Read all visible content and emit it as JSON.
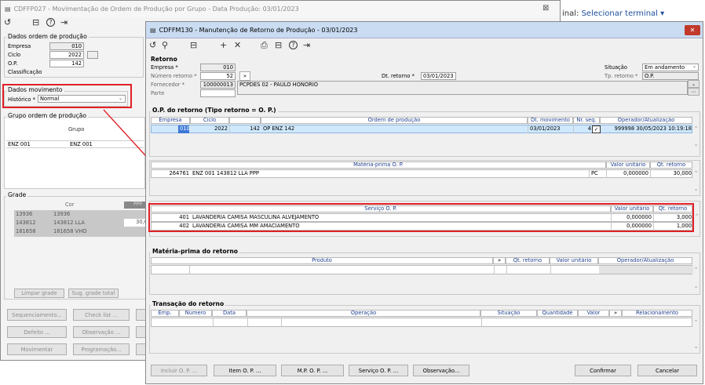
{
  "back_window": {
    "title": "CDFFP027 - Movimentação de Ordem de Produção por Grupo - Data Produção: 03/01/2023",
    "close_label": "⊠",
    "toolbar": [
      "↺",
      "⊟",
      "?",
      "⇥"
    ],
    "dados_ordem": {
      "title": "Dados ordem de produção",
      "empresa_label": "Empresa",
      "empresa": "010",
      "ciclo_label": "Ciclo",
      "ciclo": "2022",
      "op_label": "O.P.",
      "op": "142",
      "classificacao_label": "Classificação"
    },
    "dados_movimento": {
      "title": "Dados movimento",
      "historico_label": "Histórico *",
      "historico": "Normal"
    },
    "grupo": {
      "title": "Grupo ordem de produção",
      "col_grupo": "Grupo",
      "rows": [
        [
          "ENZ 001",
          "ENZ 001"
        ]
      ]
    },
    "grade": {
      "title": "Grade",
      "col_cor": "Cor",
      "col_ppp": "PPP",
      "rows": [
        [
          "13936",
          "13936",
          ""
        ],
        [
          "143812",
          "143812 LLA",
          "30,0"
        ],
        [
          "181658",
          "181658 VHO",
          ""
        ]
      ]
    },
    "grade_buttons": [
      "Limpar grade",
      "Sug. grade total"
    ],
    "buttons": [
      [
        "Sequenciamento...",
        "Check list ..."
      ],
      [
        "Defeito ...",
        "Observação ..."
      ],
      [
        "Movimentar",
        "Programação..."
      ]
    ]
  },
  "outside": {
    "terminal_prefix": "inal: ",
    "terminal_link": "Selecionar terminal ▾"
  },
  "front_window": {
    "title": "CDFFM130 - Manutenção de Retorno de Produção - 03/01/2023",
    "close_label": "✕",
    "toolbar": [
      "↺",
      "⚲",
      "⊟",
      "+",
      "✕",
      "⎙",
      "⊟",
      "?",
      "⇥"
    ],
    "retorno": {
      "section": "Retorno",
      "empresa_label": "Empresa *",
      "empresa": "010",
      "numero_label": "Número retorno *",
      "numero": "52",
      "numero_btn": "»",
      "dt_label": "Dt. retorno *",
      "dt": "03/01/2023",
      "fornecedor_label": "Fornecedor *",
      "fornecedor_code": "100000013",
      "fornecedor_name": "PCPDES 02 - PAULO HONORIO",
      "parte_label": "Parte",
      "situacao_label": "Situação",
      "situacao": "Em andamento",
      "tp_label": "Tp. retorno *",
      "tp": "O.P."
    },
    "op_section": {
      "title": "O.P. do retorno (Tipo retorno = O. P.)",
      "headers": [
        "Empresa",
        "Ciclo",
        "",
        "Ordem de produção",
        "Dt. movimento",
        "Nr. seq.",
        "Operador/Atualização"
      ],
      "row": {
        "empresa": "010",
        "ciclo": "2022",
        "op": "142",
        "op_name": "OP ENZ 142",
        "dt": "03/01/2023",
        "seq": "4",
        "check": "✓",
        "operador": "999998 30/05/2023 10:19:18"
      }
    },
    "mp_op": {
      "headers": [
        "Matéria-prima O. P.",
        "Valor unitário",
        "Qt. retorno"
      ],
      "row": {
        "code": "264761",
        "desc": "ENZ 001 143812 LLA PPP",
        "unit": "PC",
        "valor": "0,000000",
        "qt": "30,000"
      }
    },
    "servico": {
      "headers": [
        "Serviço O. P.",
        "Valor unitário",
        "Qt. retorno"
      ],
      "rows": [
        [
          "401",
          "LAVANDERIA CAMISA MASCULINA ALVEJAMENTO",
          "0,000000",
          "3,000"
        ],
        [
          "402",
          "LAVANDERIA CAMISA MM AMACIAMENTO",
          "0,000000",
          "1,000"
        ]
      ]
    },
    "mp_retorno": {
      "title": "Matéria-prima do retorno",
      "headers": [
        "Produto",
        "»",
        "Qt. retorno",
        "Valor unitário",
        "Operador/Atualização"
      ]
    },
    "transacao": {
      "title": "Transação do retorno",
      "headers": [
        "Emp.",
        "Número",
        "Data",
        "Operação",
        "Situação",
        "Quantidade",
        "Valor",
        "»",
        "Relacionamento"
      ]
    },
    "bottom_buttons": [
      "Incluir O. P. ...",
      "Item O. P. ...",
      "M.P. O. P. ...",
      "Serviço O. P. ...",
      "Observação..."
    ],
    "confirm": "Confirmar",
    "cancel": "Cancelar"
  },
  "colors": {
    "highlight": "#e21f26",
    "title_active": "#c9dcf2",
    "selected": "#cfe8fb",
    "header_text": "#1f3f8f"
  }
}
